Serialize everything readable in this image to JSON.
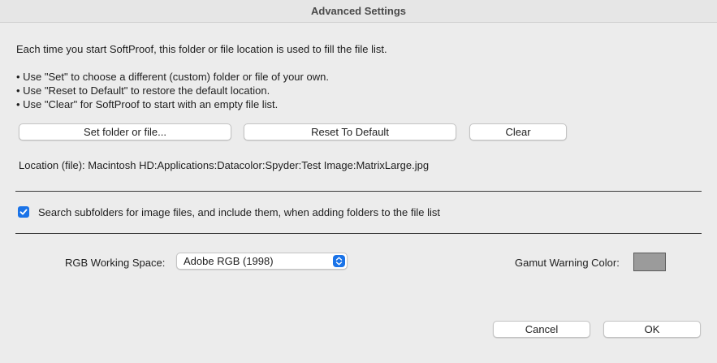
{
  "window": {
    "title": "Advanced Settings"
  },
  "intro": "Each time you start SoftProof, this folder or file location is used to fill the file list.",
  "bullets": [
    "• Use \"Set\" to choose a different (custom) folder or file of your own.",
    "• Use \"Reset to Default\" to restore the default location.",
    "• Use \"Clear\" for SoftProof to start with an empty file list."
  ],
  "buttons": {
    "set": "Set folder or file...",
    "reset": "Reset To Default",
    "clear": "Clear",
    "cancel": "Cancel",
    "ok": "OK"
  },
  "location": "Location (file): Macintosh HD:Applications:Datacolor:Spyder:Test Image:MatrixLarge.jpg",
  "subfolders": {
    "label": "Search subfolders for image files, and include them, when adding folders to the file list",
    "checked": true
  },
  "rgb": {
    "label": "RGB Working Space:",
    "value": "Adobe RGB (1998)"
  },
  "gamut": {
    "label": "Gamut Warning Color:",
    "color": "#9b9b9b"
  },
  "colors": {
    "accent": "#1a73e8"
  }
}
